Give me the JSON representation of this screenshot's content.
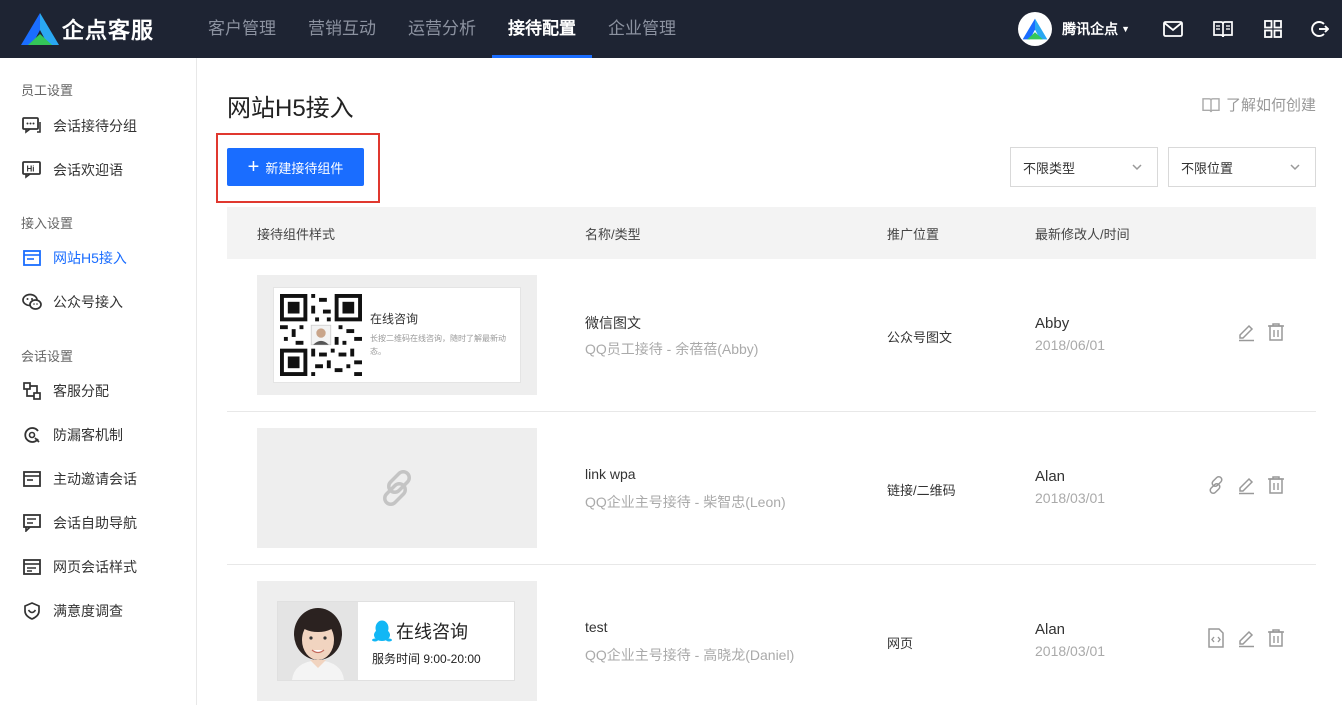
{
  "brand": {
    "name": "企点客服",
    "color": "#1a6dff"
  },
  "nav": [
    {
      "label": "客户管理",
      "active": false
    },
    {
      "label": "营销互动",
      "active": false
    },
    {
      "label": "运营分析",
      "active": false
    },
    {
      "label": "接待配置",
      "active": true
    },
    {
      "label": "企业管理",
      "active": false
    }
  ],
  "account": {
    "name": "腾讯企点"
  },
  "top_icons": [
    "mail-icon",
    "book-icon",
    "grid-icon",
    "logout-icon"
  ],
  "sidebar": {
    "groups": [
      {
        "title": "员工设置",
        "items": [
          {
            "label": "会话接待分组",
            "icon": "chat-group-icon"
          },
          {
            "label": "会话欢迎语",
            "icon": "hi-icon"
          }
        ]
      },
      {
        "title": "接入设置",
        "items": [
          {
            "label": "网站H5接入",
            "icon": "web-icon",
            "active": true
          },
          {
            "label": "公众号接入",
            "icon": "wechat-icon"
          }
        ]
      },
      {
        "title": "会话设置",
        "items": [
          {
            "label": "客服分配",
            "icon": "distribute-icon"
          },
          {
            "label": "防漏客机制",
            "icon": "protect-icon"
          },
          {
            "label": "主动邀请会话",
            "icon": "invite-icon"
          },
          {
            "label": "会话自助导航",
            "icon": "navigation-icon"
          },
          {
            "label": "网页会话样式",
            "icon": "style-icon"
          },
          {
            "label": "满意度调查",
            "icon": "survey-icon"
          }
        ]
      }
    ]
  },
  "page": {
    "title": "网站H5接入",
    "help_link": "了解如何创建",
    "new_button": "新建接待组件",
    "filter_type": "不限类型",
    "filter_position": "不限位置"
  },
  "table": {
    "columns": [
      "接待组件样式",
      "名称/类型",
      "推广位置",
      "最新修改人/时间"
    ],
    "rows": [
      {
        "name": "微信图文",
        "subtitle": "QQ员工接待 - 余蓓蓓(Abby)",
        "position": "公众号图文",
        "user": "Abby",
        "date": "2018/06/01",
        "preview": {
          "title": "在线咨询",
          "desc": "长按二维码在线咨询，随时了解最新动态。"
        },
        "actions": [
          "edit-icon",
          "delete-icon"
        ]
      },
      {
        "name": "link wpa",
        "subtitle": "QQ企业主号接待 - 柴智忠(Leon)",
        "position": "链接/二维码",
        "user": "Alan",
        "date": "2018/03/01",
        "preview": {},
        "actions": [
          "link-icon",
          "edit-icon",
          "delete-icon"
        ]
      },
      {
        "name": "test",
        "subtitle": "QQ企业主号接待 - 高晓龙(Daniel)",
        "position": "网页",
        "user": "Alan",
        "date": "2018/03/01",
        "preview": {
          "title": "在线咨询",
          "desc": "服务时间 9:00-20:00"
        },
        "actions": [
          "code-icon",
          "edit-icon",
          "delete-icon"
        ]
      }
    ]
  }
}
